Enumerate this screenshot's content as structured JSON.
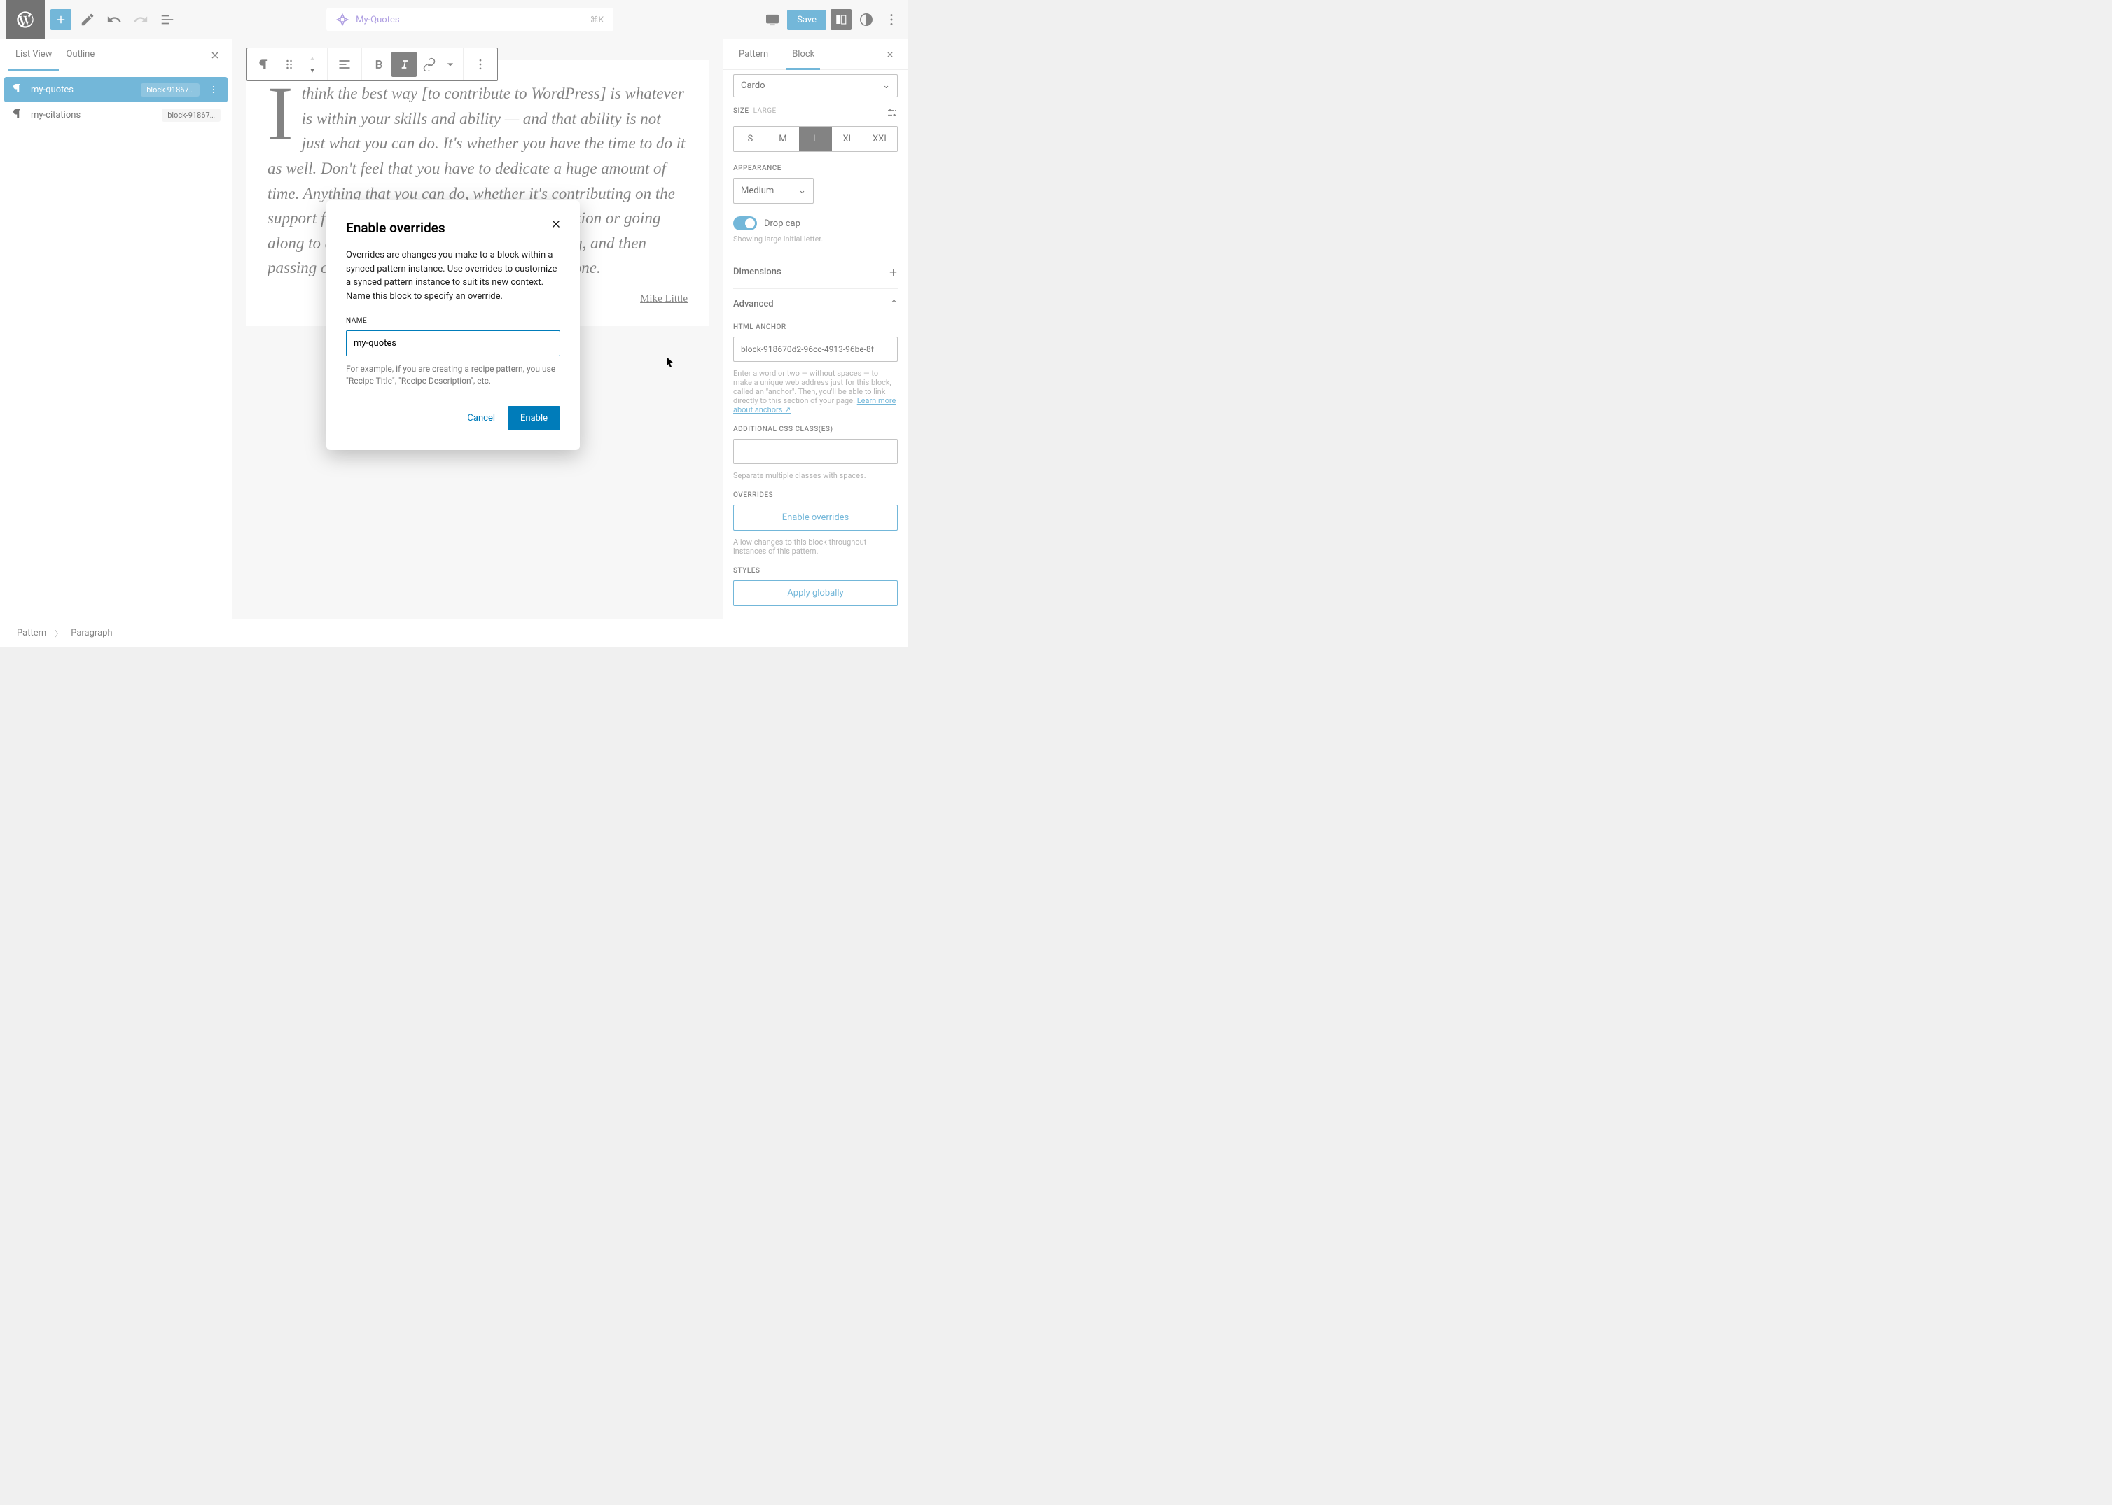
{
  "topbar": {
    "doc_title": "My-Quotes",
    "shortcut": "⌘K",
    "save_label": "Save"
  },
  "left": {
    "tabs": {
      "list_view": "List View",
      "outline": "Outline"
    },
    "tree": [
      {
        "label": "my-quotes",
        "badge": "block-91867…",
        "selected": true
      },
      {
        "label": "my-citations",
        "badge": "block-91867…",
        "selected": false
      }
    ]
  },
  "canvas": {
    "paragraph": "I think the best way [to contribute to WordPress] is whatever is within your skills and ability — and that ability is not just what you can do. It's whether you have the time to do it as well. Don't feel that you have to dedicate a huge amount of time. Anything that you can do, whether it's contributing on the support forums and answering somebody's question or going along to a meetup group and learning something, and then passing on… Take the opportunity to help someone.",
    "citation": "Mike Little"
  },
  "right": {
    "tabs": {
      "pattern": "Pattern",
      "block": "Block"
    },
    "font_family": "Cardo",
    "size_label": "SIZE",
    "size_sub": "LARGE",
    "sizes": [
      "S",
      "M",
      "L",
      "XL",
      "XXL"
    ],
    "size_active": "L",
    "appearance_label": "APPEARANCE",
    "appearance_value": "Medium",
    "dropcap_label": "Drop cap",
    "dropcap_help": "Showing large initial letter.",
    "dimensions": "Dimensions",
    "advanced": "Advanced",
    "anchor_label": "HTML ANCHOR",
    "anchor_value": "block-918670d2-96cc-4913-96be-8f",
    "anchor_help_1": "Enter a word or two — without spaces — to make a unique web address just for this block, called an \"anchor\". Then, you'll be able to link directly to this section of your page. ",
    "anchor_link": "Learn more about anchors ↗",
    "css_label": "ADDITIONAL CSS CLASS(ES)",
    "css_help": "Separate multiple classes with spaces.",
    "overrides_label": "OVERRIDES",
    "enable_overrides": "Enable overrides",
    "overrides_help": "Allow changes to this block throughout instances of this pattern.",
    "styles_label": "STYLES",
    "apply_globally": "Apply globally"
  },
  "footer": {
    "crumb1": "Pattern",
    "crumb2": "Paragraph"
  },
  "modal": {
    "title": "Enable overrides",
    "body": "Overrides are changes you make to a block within a synced pattern instance. Use overrides to customize a synced pattern instance to suit its new context. Name this block to specify an override.",
    "name_label": "NAME",
    "name_value": "my-quotes",
    "help": "For example, if you are creating a recipe pattern, you use \"Recipe Title\", \"Recipe Description\", etc.",
    "cancel": "Cancel",
    "enable": "Enable"
  }
}
